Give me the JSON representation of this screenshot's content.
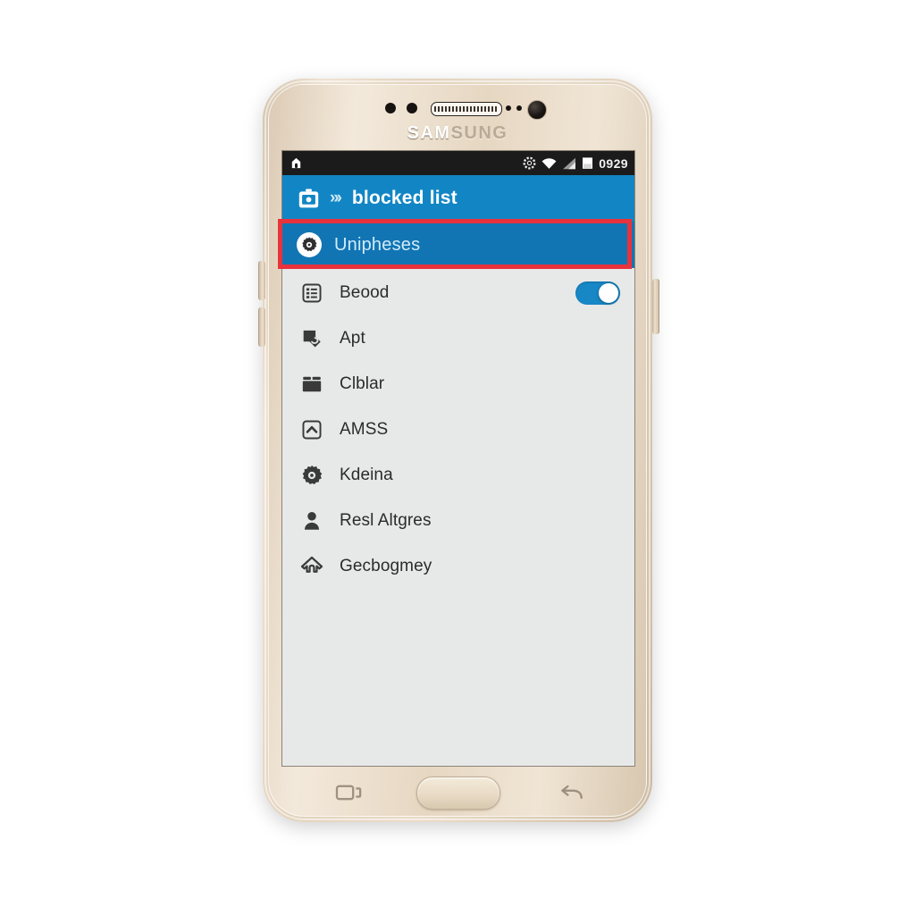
{
  "device": {
    "brand_bright": "SAM",
    "brand_dim": "SUNG",
    "body_color": "#e6d7c2",
    "nav_keys": [
      {
        "name": "recents-key",
        "label": "Recents"
      },
      {
        "name": "home-button",
        "label": "Home"
      },
      {
        "name": "back-key",
        "label": "Back"
      }
    ]
  },
  "status_bar": {
    "background": "#1b1b1b",
    "time": "0929",
    "left_icons": [
      {
        "name": "home-indicator-icon",
        "label": "Home"
      }
    ],
    "right_icons": [
      {
        "name": "sync-icon",
        "label": "Sync"
      },
      {
        "name": "wifi-icon",
        "label": "Wi-Fi"
      },
      {
        "name": "signal-icon",
        "label": "Signal"
      },
      {
        "name": "battery-icon",
        "label": "Battery"
      }
    ]
  },
  "header": {
    "title": "blocked list",
    "chevrons": "»›",
    "background": "#1286c4",
    "icon": "briefcase-icon"
  },
  "selected_row": {
    "label": "Unipheses",
    "background": "#1175b4",
    "icon": "gear-badge-icon",
    "highlight_color": "#e8323c"
  },
  "list": {
    "background": "#e7e9e9",
    "items": [
      {
        "label": "Beood",
        "icon": "list-box-icon",
        "toggle": true,
        "toggle_on": true
      },
      {
        "label": "Apt",
        "icon": "tag-icon",
        "toggle": false,
        "toggle_on": false
      },
      {
        "label": "Clblar",
        "icon": "folder-icon",
        "toggle": false,
        "toggle_on": false
      },
      {
        "label": "AMSS",
        "icon": "chevron-up-box-icon",
        "toggle": false,
        "toggle_on": false
      },
      {
        "label": "Kdeina",
        "icon": "gear-icon",
        "toggle": false,
        "toggle_on": false
      },
      {
        "label": "Resl Altgres",
        "icon": "person-icon",
        "toggle": false,
        "toggle_on": false
      },
      {
        "label": "Gecbogmey",
        "icon": "home-outline-icon",
        "toggle": false,
        "toggle_on": false
      }
    ]
  },
  "colors": {
    "accent_blue": "#1286c4",
    "selected_blue": "#1175b4",
    "annotation_red": "#e8323c",
    "screen_grey": "#e7e9e9",
    "text_dark": "#2b2b2b"
  }
}
